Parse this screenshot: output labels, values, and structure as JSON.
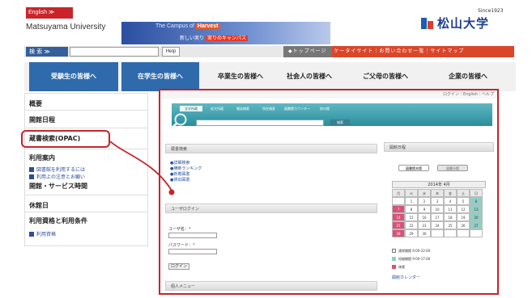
{
  "header": {
    "lang_button": "English ≫",
    "university_name": "Matsuyama University",
    "banner_line1": "The Campus of",
    "banner_highlight": "Harvest",
    "banner_line2_a": "新しい実り",
    "banner_line2_b": "実りのキャンパス",
    "logo_since": "Since1923",
    "logo_name": "松山大学"
  },
  "search": {
    "button_label": "検 索 ≫",
    "help_label": "Help",
    "home_link": "◆トップページ",
    "links": "ケータイサイト｜お問い合わせ一覧｜サイトマップ"
  },
  "nav": [
    {
      "label": "受験生の皆様へ"
    },
    {
      "label": "在学生の皆様へ"
    },
    {
      "label": "卒業生の皆様へ"
    },
    {
      "label": "社会人の皆様へ"
    },
    {
      "label": "ご父母の皆様へ"
    },
    {
      "label": "企業の皆様へ"
    }
  ],
  "sidebar": {
    "items": [
      {
        "label": "概要"
      },
      {
        "label": "開館日程"
      },
      {
        "label": "蔵書検索(OPAC)"
      },
      {
        "label": "利用案内"
      },
      {
        "label": "図書館を利用するには"
      },
      {
        "label": "利用上の注意とお願い"
      },
      {
        "label": "開館・サービス時間"
      },
      {
        "label": "休館日"
      },
      {
        "label": "利用資格と利用条件"
      },
      {
        "label": "利用資格"
      }
    ]
  },
  "opac": {
    "top_links": "ログイン｜English｜ヘルプ",
    "tabs": [
      "全学所蔵",
      "松大所蔵",
      "雑誌検索",
      "所在検索",
      "図書館カウンター",
      "他の館"
    ],
    "search_button": "検索",
    "panel_search_title": "蔵書検索",
    "search_links": [
      "●詳細検索",
      "●横断ランキング",
      "●新着図書",
      "●貸出図書"
    ],
    "panel_login_title": "ユーザログイン",
    "user_label": "ユーザ名：",
    "password_label": "パスワード：",
    "login_button": "ログイン",
    "panel_menu_title": "個人メニュー",
    "calendar_title": "開館日程",
    "calendar_tabs": [
      "図書館本館",
      "図書分館"
    ],
    "calendar_month": "2014年 4月",
    "calendar_days": [
      "月",
      "火",
      "水",
      "木",
      "金",
      "土",
      "日"
    ],
    "calendar_rows": [
      [
        "",
        "1",
        "2",
        "3",
        "4",
        "5",
        "6"
      ],
      [
        "7",
        "8",
        "9",
        "10",
        "11",
        "12",
        "13"
      ],
      [
        "14",
        "15",
        "16",
        "17",
        "18",
        "19",
        "20"
      ],
      [
        "21",
        "22",
        "23",
        "24",
        "25",
        "26",
        "27"
      ],
      [
        "28",
        "29",
        "30",
        "",
        "",
        "",
        ""
      ]
    ],
    "legend": [
      "通常開館 9:00-22:00",
      "短縮開館 9:00-17:00",
      "休館"
    ],
    "calendar_link": "開館カレンダー"
  },
  "colors": {
    "highlight_red": "#c6242c",
    "nav_blue": "#2f6aac",
    "teal": "#2b8d9c",
    "orange": "#d9472b"
  }
}
